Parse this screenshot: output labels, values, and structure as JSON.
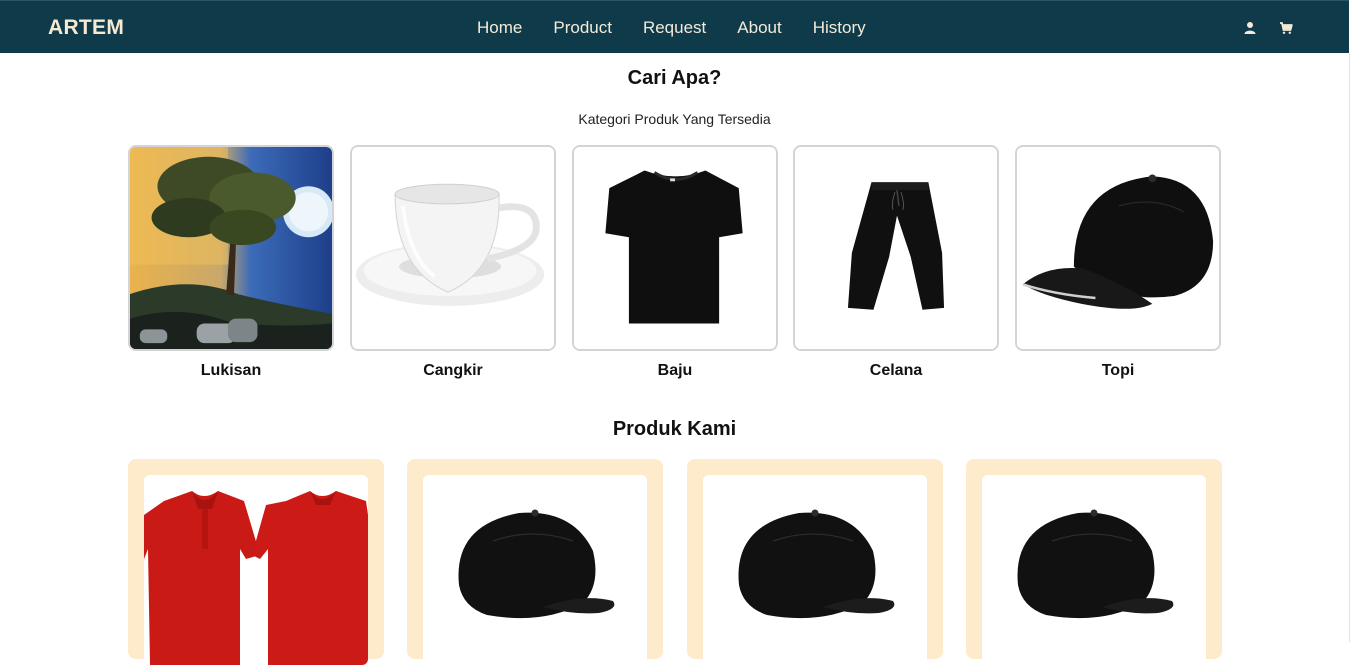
{
  "navbar": {
    "brand": "ARTEM",
    "links": [
      "Home",
      "Product",
      "Request",
      "About",
      "History"
    ],
    "icons": [
      "user-icon",
      "cart-icon"
    ]
  },
  "categories_section": {
    "title": "Cari Apa?",
    "subtitle": "Kategori Produk Yang Tersedia",
    "items": [
      {
        "label": "Lukisan",
        "image": "painting-tree-moon"
      },
      {
        "label": "Cangkir",
        "image": "white-cup-saucer"
      },
      {
        "label": "Baju",
        "image": "black-tshirt"
      },
      {
        "label": "Celana",
        "image": "black-pants"
      },
      {
        "label": "Topi",
        "image": "black-cap"
      }
    ]
  },
  "products_section": {
    "title": "Produk Kami",
    "items": [
      {
        "image": "red-polo-shirts"
      },
      {
        "image": "black-cap"
      },
      {
        "image": "black-cap"
      },
      {
        "image": "black-cap"
      }
    ]
  },
  "colors": {
    "navbar_bg": "#0f3a4a",
    "nav_text": "#f4ead9",
    "product_card_bg": "#fdebcc"
  }
}
